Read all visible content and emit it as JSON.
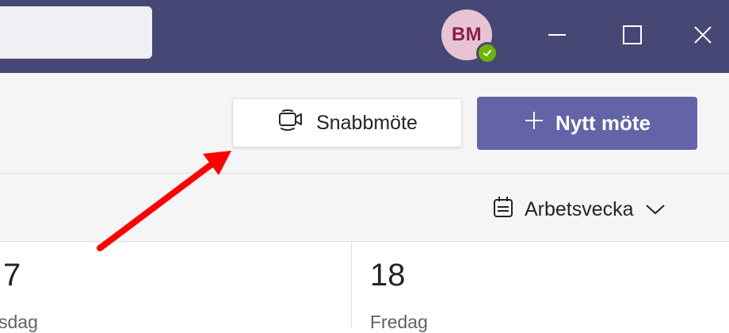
{
  "user": {
    "initials": "BM",
    "presence": "available"
  },
  "window_controls": {
    "minimize": "minimize-icon",
    "maximize": "maximize-icon",
    "close": "close-icon"
  },
  "toolbar": {
    "quick_meeting_label": "Snabbmöte",
    "new_meeting_label": "Nytt möte"
  },
  "view": {
    "label": "Arbetsvecka"
  },
  "calendar": {
    "days": [
      {
        "number": "7",
        "name": "sdag"
      },
      {
        "number": "18",
        "name": "Fredag"
      }
    ]
  },
  "colors": {
    "titlebar": "#464775",
    "primary_button": "#6264a7",
    "avatar_bg": "#e7c4d1",
    "presence_green": "#6bb700",
    "annotation_arrow": "#ff0000"
  }
}
